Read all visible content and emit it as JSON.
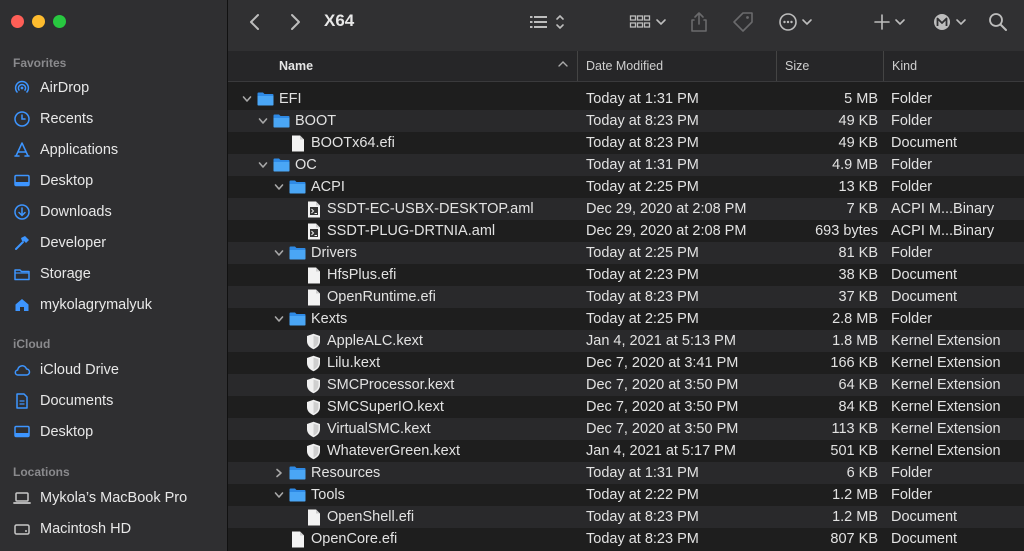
{
  "window": {
    "title": "X64"
  },
  "sidebar": {
    "favorites_label": "Favorites",
    "favorites": [
      {
        "label": "AirDrop",
        "icon": "airdrop-icon"
      },
      {
        "label": "Recents",
        "icon": "clock-icon"
      },
      {
        "label": "Applications",
        "icon": "applications-icon"
      },
      {
        "label": "Desktop",
        "icon": "desktop-icon"
      },
      {
        "label": "Downloads",
        "icon": "downloads-icon"
      },
      {
        "label": "Developer",
        "icon": "hammer-icon"
      },
      {
        "label": "Storage",
        "icon": "folder-icon"
      },
      {
        "label": "mykolagrymalyuk",
        "icon": "home-icon"
      }
    ],
    "icloud_label": "iCloud",
    "icloud": [
      {
        "label": "iCloud Drive",
        "icon": "cloud-icon"
      },
      {
        "label": "Documents",
        "icon": "document-icon"
      },
      {
        "label": "Desktop",
        "icon": "desktop-icon"
      }
    ],
    "locations_label": "Locations",
    "locations": [
      {
        "label": "Mykola’s MacBook Pro",
        "icon": "laptop-icon"
      },
      {
        "label": "Macintosh HD",
        "icon": "disk-icon"
      }
    ]
  },
  "columns": {
    "name": "Name",
    "date": "Date Modified",
    "size": "Size",
    "kind": "Kind"
  },
  "files": [
    {
      "depth": 0,
      "disclosure": "open",
      "icon": "folder",
      "name": "EFI",
      "date": "Today at 1:31 PM",
      "size": "5 MB",
      "kind": "Folder"
    },
    {
      "depth": 1,
      "disclosure": "open",
      "icon": "folder",
      "name": "BOOT",
      "date": "Today at 8:23 PM",
      "size": "49 KB",
      "kind": "Folder"
    },
    {
      "depth": 2,
      "disclosure": "none",
      "icon": "doc",
      "name": "BOOTx64.efi",
      "date": "Today at 8:23 PM",
      "size": "49 KB",
      "kind": "Document"
    },
    {
      "depth": 1,
      "disclosure": "open",
      "icon": "folder",
      "name": "OC",
      "date": "Today at 1:31 PM",
      "size": "4.9 MB",
      "kind": "Folder"
    },
    {
      "depth": 2,
      "disclosure": "open",
      "icon": "folder",
      "name": "ACPI",
      "date": "Today at 2:25 PM",
      "size": "13 KB",
      "kind": "Folder"
    },
    {
      "depth": 3,
      "disclosure": "none",
      "icon": "aml",
      "name": "SSDT-EC-USBX-DESKTOP.aml",
      "date": "Dec 29, 2020 at 2:08 PM",
      "size": "7 KB",
      "kind": "ACPI M...Binary"
    },
    {
      "depth": 3,
      "disclosure": "none",
      "icon": "aml",
      "name": "SSDT-PLUG-DRTNIA.aml",
      "date": "Dec 29, 2020 at 2:08 PM",
      "size": "693 bytes",
      "kind": "ACPI M...Binary"
    },
    {
      "depth": 2,
      "disclosure": "open",
      "icon": "folder",
      "name": "Drivers",
      "date": "Today at 2:25 PM",
      "size": "81 KB",
      "kind": "Folder"
    },
    {
      "depth": 3,
      "disclosure": "none",
      "icon": "doc",
      "name": "HfsPlus.efi",
      "date": "Today at 2:23 PM",
      "size": "38 KB",
      "kind": "Document"
    },
    {
      "depth": 3,
      "disclosure": "none",
      "icon": "doc",
      "name": "OpenRuntime.efi",
      "date": "Today at 8:23 PM",
      "size": "37 KB",
      "kind": "Document"
    },
    {
      "depth": 2,
      "disclosure": "open",
      "icon": "folder",
      "name": "Kexts",
      "date": "Today at 2:25 PM",
      "size": "2.8 MB",
      "kind": "Folder"
    },
    {
      "depth": 3,
      "disclosure": "none",
      "icon": "kext",
      "name": "AppleALC.kext",
      "date": "Jan 4, 2021 at 5:13 PM",
      "size": "1.8 MB",
      "kind": "Kernel Extension"
    },
    {
      "depth": 3,
      "disclosure": "none",
      "icon": "kext",
      "name": "Lilu.kext",
      "date": "Dec 7, 2020 at 3:41 PM",
      "size": "166 KB",
      "kind": "Kernel Extension"
    },
    {
      "depth": 3,
      "disclosure": "none",
      "icon": "kext",
      "name": "SMCProcessor.kext",
      "date": "Dec 7, 2020 at 3:50 PM",
      "size": "64 KB",
      "kind": "Kernel Extension"
    },
    {
      "depth": 3,
      "disclosure": "none",
      "icon": "kext",
      "name": "SMCSuperIO.kext",
      "date": "Dec 7, 2020 at 3:50 PM",
      "size": "84 KB",
      "kind": "Kernel Extension"
    },
    {
      "depth": 3,
      "disclosure": "none",
      "icon": "kext",
      "name": "VirtualSMC.kext",
      "date": "Dec 7, 2020 at 3:50 PM",
      "size": "113 KB",
      "kind": "Kernel Extension"
    },
    {
      "depth": 3,
      "disclosure": "none",
      "icon": "kext",
      "name": "WhateverGreen.kext",
      "date": "Jan 4, 2021 at 5:17 PM",
      "size": "501 KB",
      "kind": "Kernel Extension"
    },
    {
      "depth": 2,
      "disclosure": "closed",
      "icon": "folder",
      "name": "Resources",
      "date": "Today at 1:31 PM",
      "size": "6 KB",
      "kind": "Folder"
    },
    {
      "depth": 2,
      "disclosure": "open",
      "icon": "folder",
      "name": "Tools",
      "date": "Today at 2:22 PM",
      "size": "1.2 MB",
      "kind": "Folder"
    },
    {
      "depth": 3,
      "disclosure": "none",
      "icon": "doc",
      "name": "OpenShell.efi",
      "date": "Today at 8:23 PM",
      "size": "1.2 MB",
      "kind": "Document"
    },
    {
      "depth": 2,
      "disclosure": "none",
      "icon": "doc",
      "name": "OpenCore.efi",
      "date": "Today at 8:23 PM",
      "size": "807 KB",
      "kind": "Document"
    }
  ],
  "colors": {
    "accent": "#3d95ff",
    "folder": "#3a9cf0",
    "sidebar_bg": "#2f2f31",
    "list_bg": "#1e1e1e",
    "row_alt": "#29292b"
  }
}
